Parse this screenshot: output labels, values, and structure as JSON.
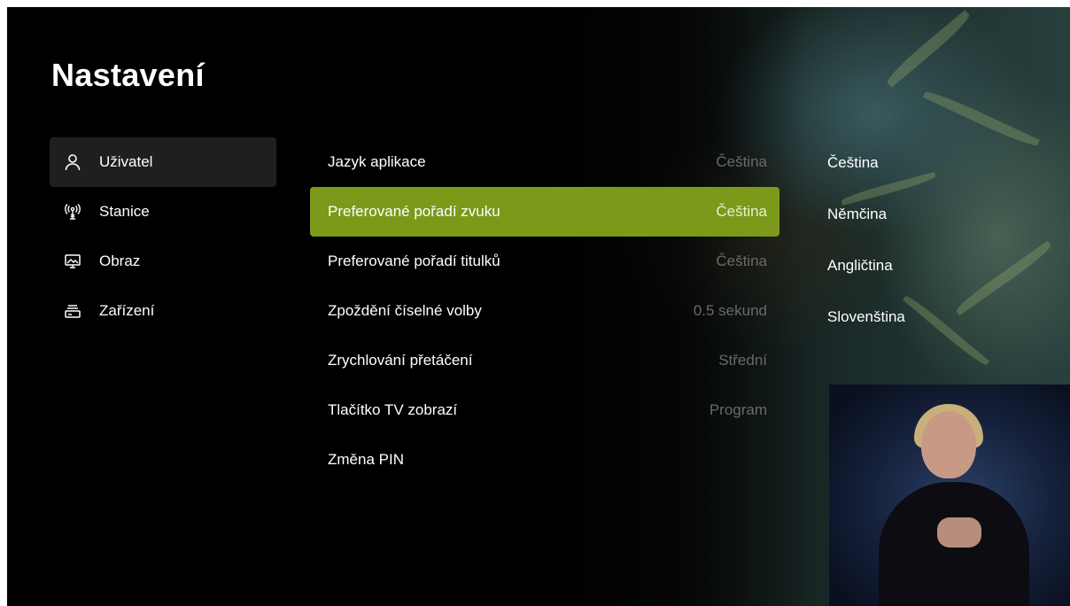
{
  "page_title": "Nastavení",
  "sidebar": {
    "items": [
      {
        "label": "Uživatel",
        "icon": "user-icon",
        "active": true
      },
      {
        "label": "Stanice",
        "icon": "antenna-icon",
        "active": false
      },
      {
        "label": "Obraz",
        "icon": "monitor-icon",
        "active": false
      },
      {
        "label": "Zařízení",
        "icon": "set-top-box-icon",
        "active": false
      }
    ]
  },
  "settings": {
    "rows": [
      {
        "label": "Jazyk aplikace",
        "value": "Čeština"
      },
      {
        "label": "Preferované pořadí zvuku",
        "value": "Čeština"
      },
      {
        "label": "Preferované pořadí titulků",
        "value": "Čeština"
      },
      {
        "label": "Zpoždění číselné volby",
        "value": "0.5 sekund"
      },
      {
        "label": "Zrychlování přetáčení",
        "value": "Střední"
      },
      {
        "label": "Tlačítko TV zobrazí",
        "value": "Program"
      },
      {
        "label": "Změna PIN",
        "value": ""
      }
    ],
    "selected_index": 1
  },
  "options": {
    "items": [
      "Čeština",
      "Němčina",
      "Angličtina",
      "Slovenština"
    ]
  },
  "colors": {
    "accent": "#7b9a1a",
    "background": "#000000",
    "sidebar_active": "#1f1f1f",
    "value_text": "#6a6a6a"
  }
}
